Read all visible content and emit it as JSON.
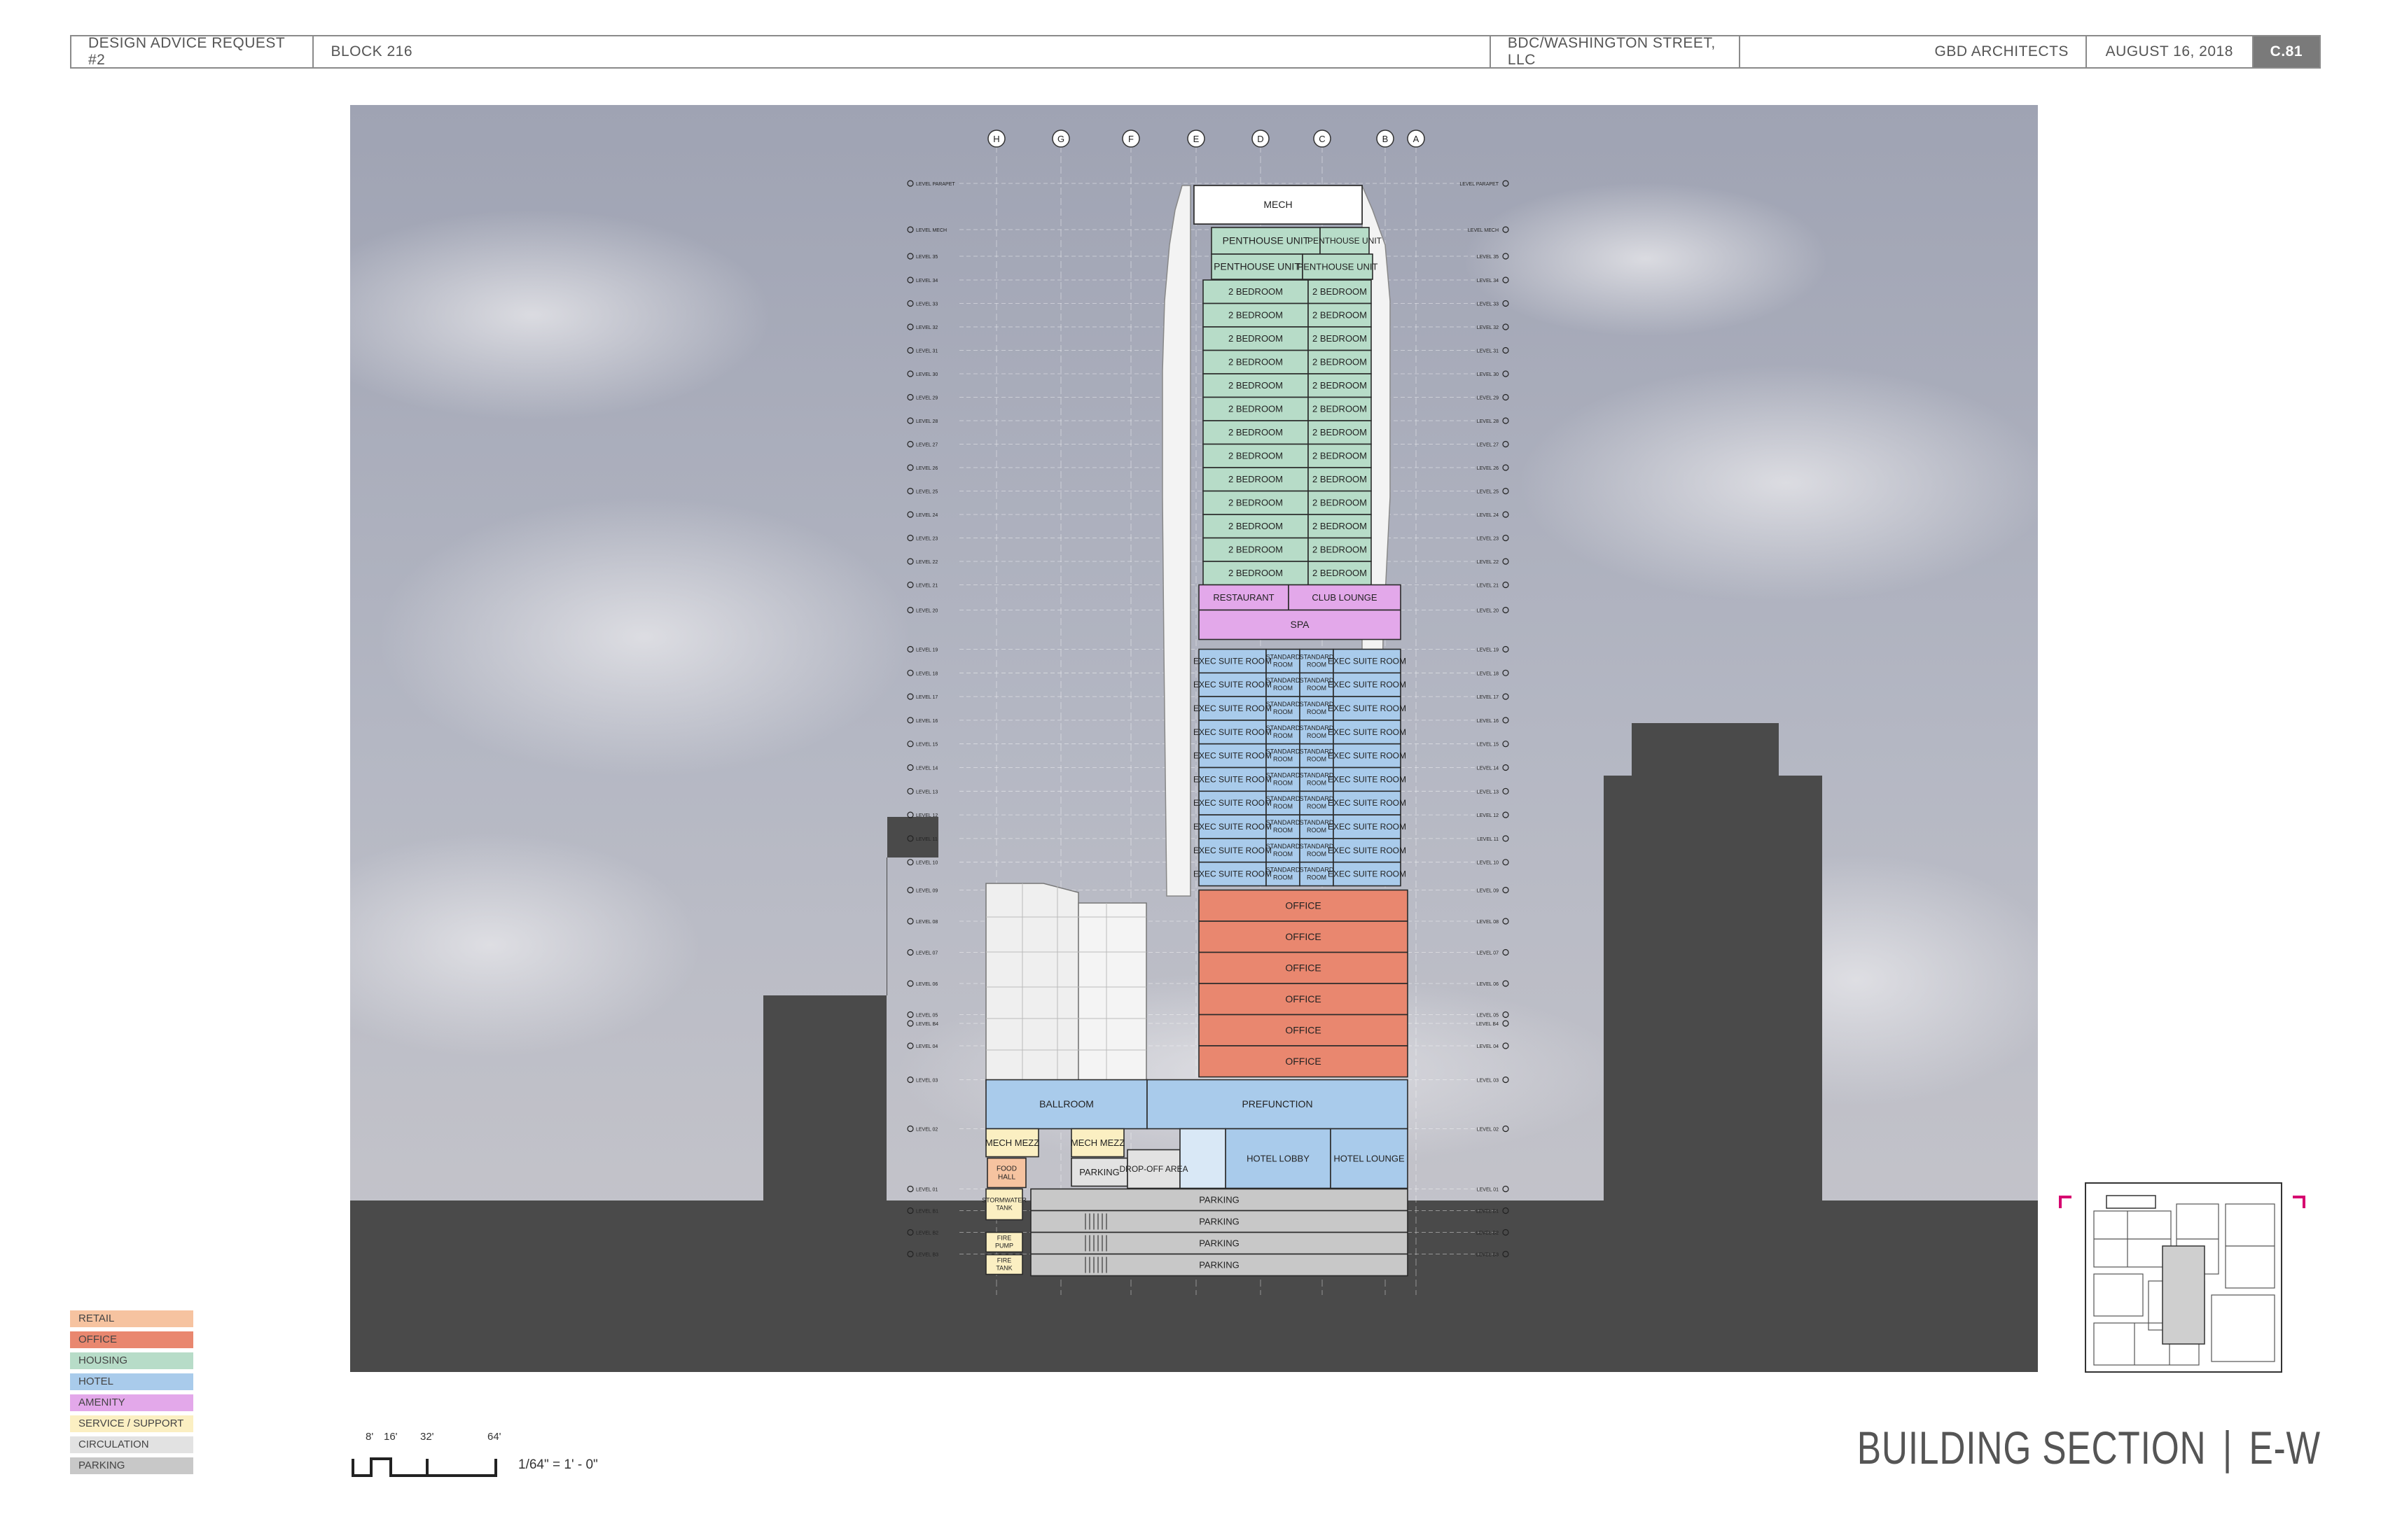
{
  "title_block": {
    "project": "DESIGN ADVICE REQUEST #2",
    "block": "BLOCK 216",
    "owner": "BDC/WASHINGTON STREET, LLC",
    "architect": "GBD ARCHITECTS",
    "date": "AUGUST 16,  2018",
    "sheet": "C.81"
  },
  "grid_lines": [
    "H",
    "G",
    "F",
    "E",
    "D",
    "C",
    "B",
    "A"
  ],
  "levels": [
    "LEVEL PARAPET",
    "LEVEL MECH",
    "LEVEL 35",
    "LEVEL 34",
    "LEVEL 33",
    "LEVEL 32",
    "LEVEL 31",
    "LEVEL 30",
    "LEVEL 29",
    "LEVEL 28",
    "LEVEL 27",
    "LEVEL 26",
    "LEVEL 25",
    "LEVEL 24",
    "LEVEL 23",
    "LEVEL 22",
    "LEVEL 21",
    "LEVEL 20",
    "LEVEL 19",
    "LEVEL 18",
    "LEVEL 17",
    "LEVEL 16",
    "LEVEL 15",
    "LEVEL 14",
    "LEVEL 13",
    "LEVEL 12",
    "LEVEL 11",
    "LEVEL 10",
    "LEVEL 09",
    "LEVEL 08",
    "LEVEL 07",
    "LEVEL 06",
    "LEVEL 05",
    "LEVEL 04",
    "LEVEL 03",
    "LEVEL 02",
    "LEVEL 01",
    "LEVEL B1",
    "LEVEL B2",
    "LEVEL B3",
    "LEVEL B4"
  ],
  "rooms": {
    "mech": "MECH",
    "penthouse": "PENTHOUSE UNIT",
    "two_bed": "2 BEDROOM",
    "restaurant": "RESTAURANT",
    "club_lounge": "CLUB LOUNGE",
    "spa": "SPA",
    "exec_suite": "EXEC SUITE ROOM",
    "standard_room": "STANDARD ROOM",
    "office": "OFFICE",
    "ballroom": "BALLROOM",
    "prefunction": "PREFUNCTION",
    "mech_mezz": "MECH MEZZ",
    "food_hall": "FOOD HALL",
    "parking": "PARKING",
    "drop_off": "DROP-OFF AREA",
    "hotel_lobby": "HOTEL LOBBY",
    "hotel_lounge": "HOTEL LOUNGE",
    "stormwater": "STORMWATER TANK",
    "fire_pump": "FIRE PUMP",
    "fire_tank": "FIRE TANK"
  },
  "legend": [
    {
      "label": "RETAIL",
      "color": "#f6c3a0"
    },
    {
      "label": "OFFICE",
      "color": "#e9876f"
    },
    {
      "label": "HOUSING",
      "color": "#b7dcc8"
    },
    {
      "label": "HOTEL",
      "color": "#a9cbeb"
    },
    {
      "label": "AMENITY",
      "color": "#e3a8ea"
    },
    {
      "label": "SERVICE / SUPPORT",
      "color": "#fbefc2"
    },
    {
      "label": "CIRCULATION",
      "color": "#e2e2e2"
    },
    {
      "label": "PARKING",
      "color": "#c8c8c8"
    }
  ],
  "scale": {
    "ticks": [
      "8'",
      "16'",
      "32'",
      "64'"
    ],
    "note": "1/64\" = 1' - 0\""
  },
  "sheet_title": {
    "main": "BUILDING SECTION",
    "separator": "|",
    "sub": "E-W"
  },
  "colors": {
    "housing": "#b7dcc8",
    "hotel": "#a9cbeb",
    "office": "#e9876f",
    "amenity": "#e3a8ea",
    "service": "#fbefc2",
    "retail": "#f6c3a0",
    "parking": "#c8c8c8",
    "circulation": "#e2e2e2",
    "neighbor": "#4a4a4a",
    "key_marker": "#d6006f"
  }
}
